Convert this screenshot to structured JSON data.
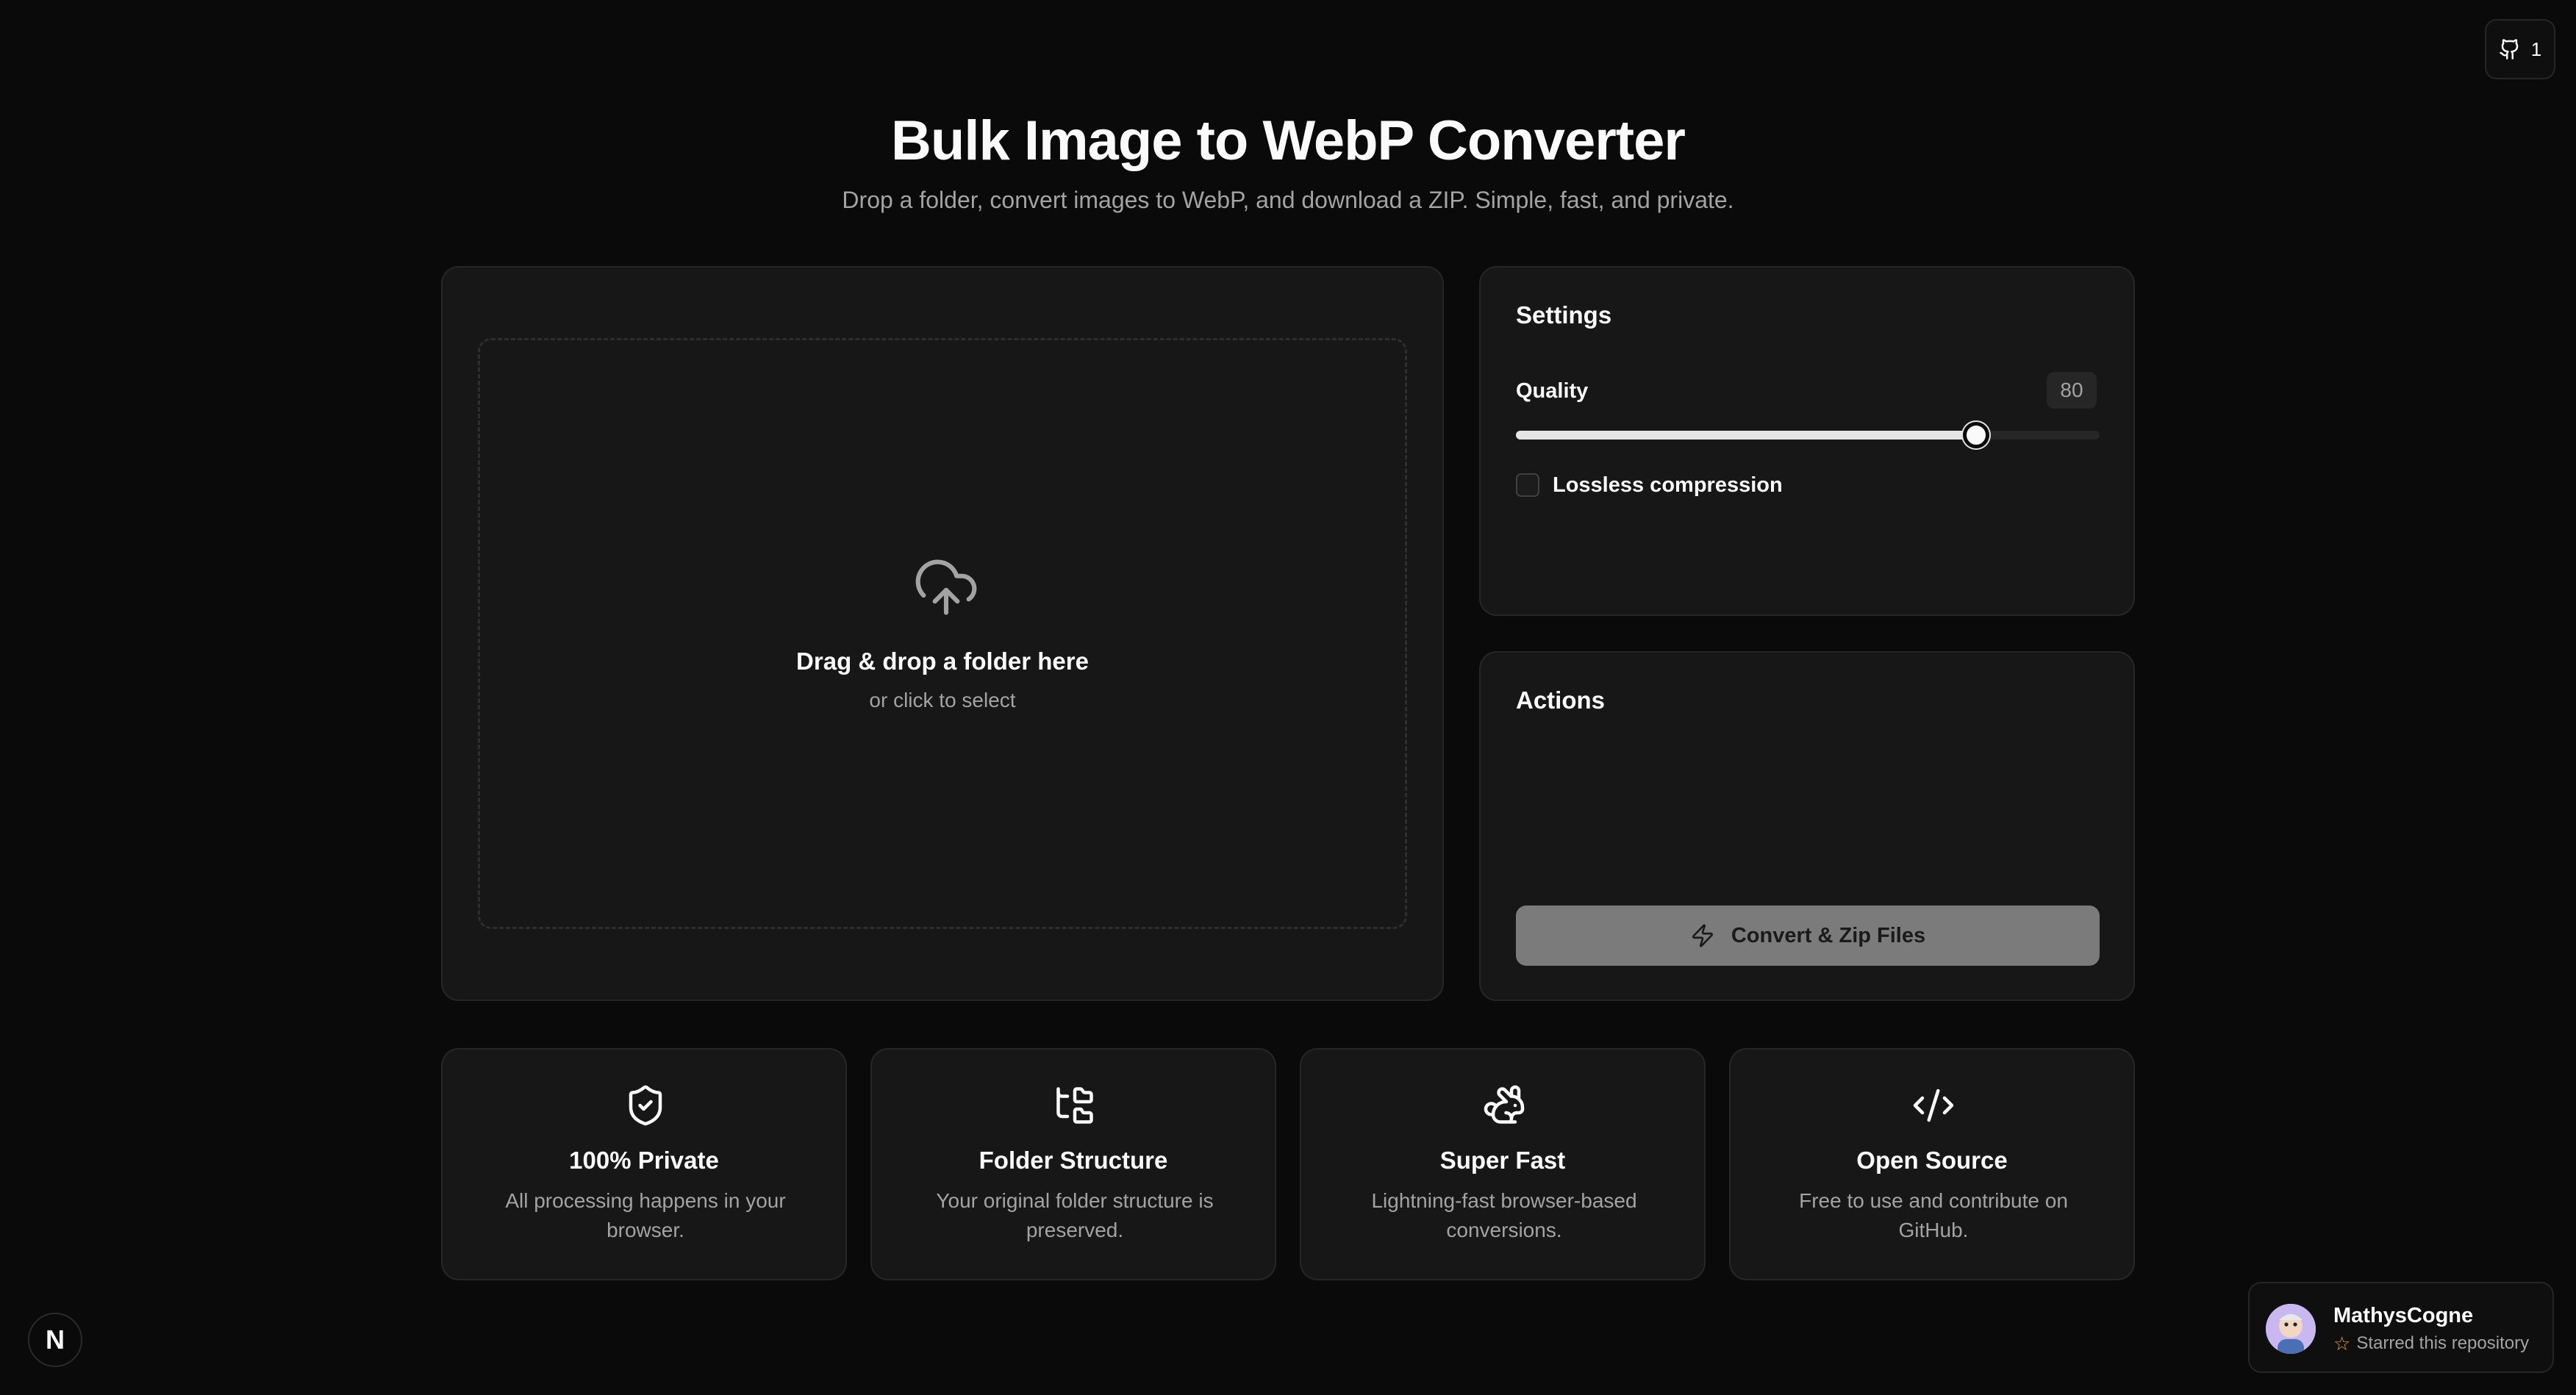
{
  "header": {
    "title": "Bulk Image to WebP Converter",
    "subtitle": "Drop a folder, convert images to WebP, and download a ZIP. Simple, fast, and private."
  },
  "github_badge": {
    "icon": "github-icon",
    "count": "1"
  },
  "dropzone": {
    "icon": "cloud-upload-icon",
    "title": "Drag & drop a folder here",
    "subtitle": "or click to select"
  },
  "settings": {
    "title": "Settings",
    "quality_label": "Quality",
    "quality_value": "80",
    "quality_percent": 80,
    "lossless_label": "Lossless compression",
    "lossless_checked": false
  },
  "actions": {
    "title": "Actions",
    "convert_label": "Convert & Zip Files",
    "convert_icon": "zap-icon"
  },
  "features": [
    {
      "icon": "shield-check-icon",
      "title": "100% Private",
      "description": "All processing happens in your browser."
    },
    {
      "icon": "folder-tree-icon",
      "title": "Folder Structure",
      "description": "Your original folder structure is preserved."
    },
    {
      "icon": "rabbit-icon",
      "title": "Super Fast",
      "description": "Lightning-fast browser-based conversions."
    },
    {
      "icon": "code-icon",
      "title": "Open Source",
      "description": "Free to use and contribute on GitHub."
    }
  ],
  "next_indicator": {
    "letter": "N"
  },
  "toast": {
    "name": "MathysCogne",
    "action": "Starred this repository",
    "icon": "star-icon"
  },
  "colors": {
    "background": "#0a0a0a",
    "card": "#171717",
    "border": "#262626",
    "muted_text": "#a3a3a3",
    "button_disabled": "#7b7b7b",
    "star": "#e5a50a"
  }
}
